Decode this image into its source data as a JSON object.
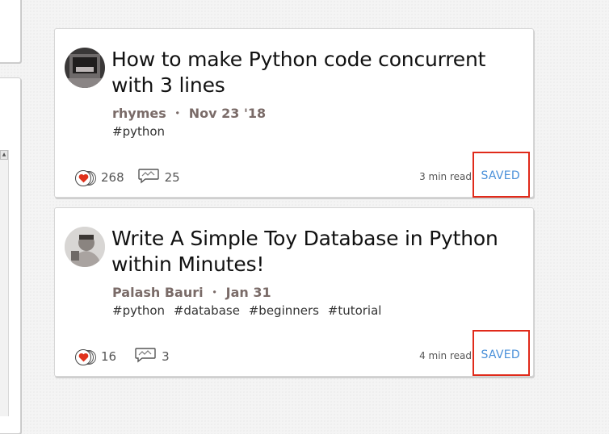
{
  "cards": [
    {
      "title": "How to make Python code concurrent with 3 lines",
      "author": "rhymes",
      "date": "Nov 23 '18",
      "tags": [
        "#python"
      ],
      "reactions": "268",
      "comments": "25",
      "read_time": "3 min read",
      "save_label": "SAVED"
    },
    {
      "title": "Write A Simple Toy Database in Python within Minutes!",
      "author": "Palash Bauri",
      "date": "Jan 31",
      "tags": [
        "#python",
        "#database",
        "#beginners",
        "#tutorial"
      ],
      "reactions": "16",
      "comments": "3",
      "read_time": "4 min read",
      "save_label": "SAVED"
    }
  ],
  "meta_separator": "・",
  "colors": {
    "highlight": "#e02a1a",
    "saved": "#4a90d9",
    "heart": "#e0321c"
  }
}
